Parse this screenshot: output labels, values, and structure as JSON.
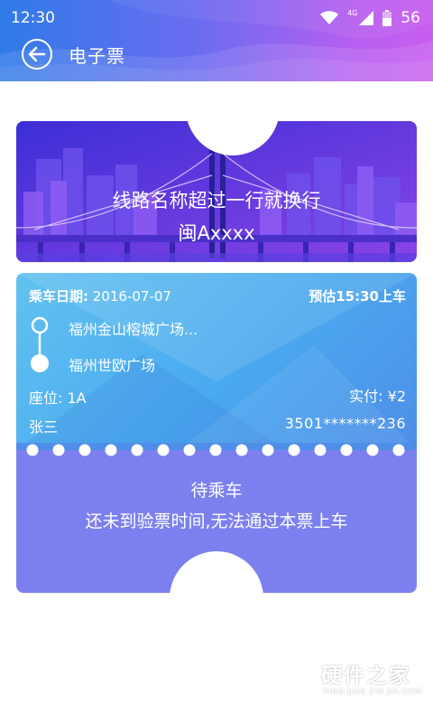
{
  "status_bar": {
    "time": "12:30",
    "network": "4G",
    "battery": "56"
  },
  "navbar": {
    "title": "电子票",
    "back_icon": "arrow-left-icon"
  },
  "ticket": {
    "route_name": "线路名称超过一行就换行",
    "plate_number": "闽Axxxx",
    "ride_date_label": "乘车日期:",
    "ride_date_value": "2016-07-07",
    "estimated_time": "预估15:30上车",
    "stop_from": "福州金山榕城广场...",
    "stop_to": "福州世欧广场",
    "seat": "座位: 1A",
    "paid": "实付: ¥2",
    "passenger_name": "张三",
    "id_number": "3501*******236",
    "status_title": "待乘车",
    "status_description": "还未到验票时间,无法通过本票上车"
  },
  "watermark": {
    "name": "硬件之家",
    "sub": "YING JIAN ZHI JIA.COM"
  },
  "colors": {
    "header_start": "#2f7be8",
    "header_end": "#c95df0",
    "ticket_top": "#6a3fe0",
    "ticket_mid": "#4aa9ef",
    "ticket_bottom": "#7c80ef"
  }
}
